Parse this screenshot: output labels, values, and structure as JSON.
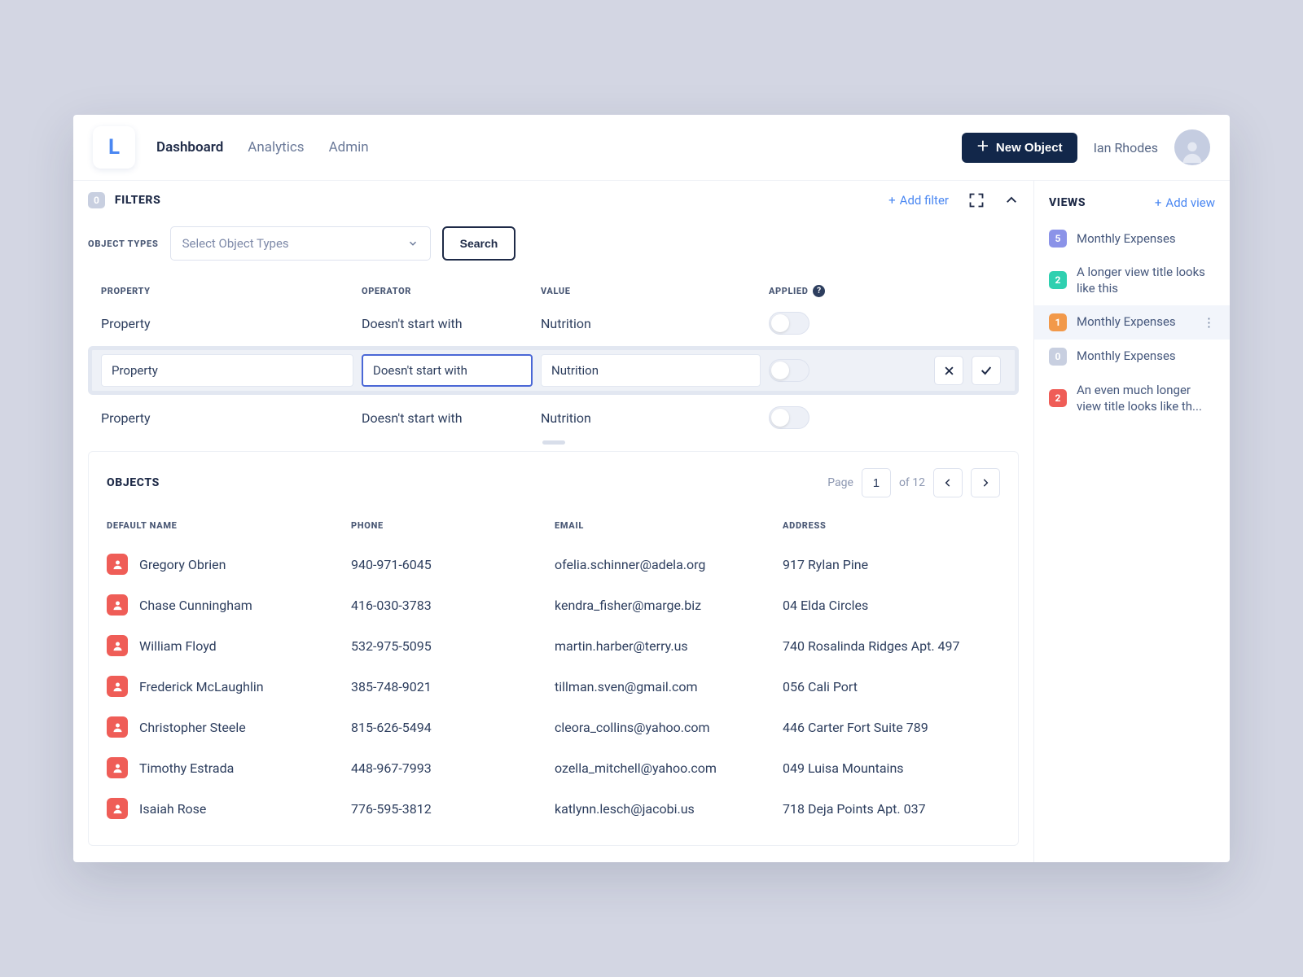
{
  "logo": "L",
  "nav": {
    "dashboard": "Dashboard",
    "analytics": "Analytics",
    "admin": "Admin"
  },
  "new_object_label": "New Object",
  "user": {
    "name": "Ian Rhodes"
  },
  "filters": {
    "title": "FILTERS",
    "badge": "0",
    "add_filter": "Add filter",
    "object_types_label": "OBJECT TYPES",
    "select_placeholder": "Select Object Types",
    "search_label": "Search",
    "columns": {
      "property": "PROPERTY",
      "operator": "OPERATOR",
      "value": "VALUE",
      "applied": "APPLIED"
    },
    "rows": [
      {
        "property": "Property",
        "operator": "Doesn't start with",
        "value": "Nutrition"
      },
      {
        "property": "Property",
        "operator": "Doesn't start with",
        "value": "Nutrition"
      },
      {
        "property": "Property",
        "operator": "Doesn't start with",
        "value": "Nutrition"
      }
    ]
  },
  "objects": {
    "title": "OBJECTS",
    "page_label": "Page",
    "page_current": "1",
    "page_of": "of 12",
    "columns": {
      "name": "DEFAULT NAME",
      "phone": "PHONE",
      "email": "EMAIL",
      "address": "ADDRESS"
    },
    "rows": [
      {
        "name": "Gregory Obrien",
        "phone": "940-971-6045",
        "email": "ofelia.schinner@adela.org",
        "address": "917 Rylan Pine"
      },
      {
        "name": "Chase Cunningham",
        "phone": "416-030-3783",
        "email": "kendra_fisher@marge.biz",
        "address": "04 Elda Circles"
      },
      {
        "name": "William Floyd",
        "phone": "532-975-5095",
        "email": "martin.harber@terry.us",
        "address": "740 Rosalinda Ridges Apt. 497"
      },
      {
        "name": "Frederick McLaughlin",
        "phone": "385-748-9021",
        "email": "tillman.sven@gmail.com",
        "address": "056 Cali Port"
      },
      {
        "name": "Christopher Steele",
        "phone": "815-626-5494",
        "email": "cleora_collins@yahoo.com",
        "address": "446 Carter Fort Suite 789"
      },
      {
        "name": "Timothy Estrada",
        "phone": "448-967-7993",
        "email": "ozella_mitchell@yahoo.com",
        "address": "049 Luisa Mountains"
      },
      {
        "name": "Isaiah Rose",
        "phone": "776-595-3812",
        "email": "katlynn.lesch@jacobi.us",
        "address": "718 Deja Points Apt. 037"
      }
    ]
  },
  "views": {
    "title": "VIEWS",
    "add_view": "Add view",
    "items": [
      {
        "badge": "5",
        "color": "vb-purple",
        "label": "Monthly Expenses"
      },
      {
        "badge": "2",
        "color": "vb-teal",
        "label": "A longer view title looks like this"
      },
      {
        "badge": "1",
        "color": "vb-orange",
        "label": "Monthly Expenses",
        "active": true
      },
      {
        "badge": "0",
        "color": "vb-gray",
        "label": "Monthly Expenses"
      },
      {
        "badge": "2",
        "color": "vb-red",
        "label": "An even much longer view title looks like th..."
      }
    ]
  }
}
